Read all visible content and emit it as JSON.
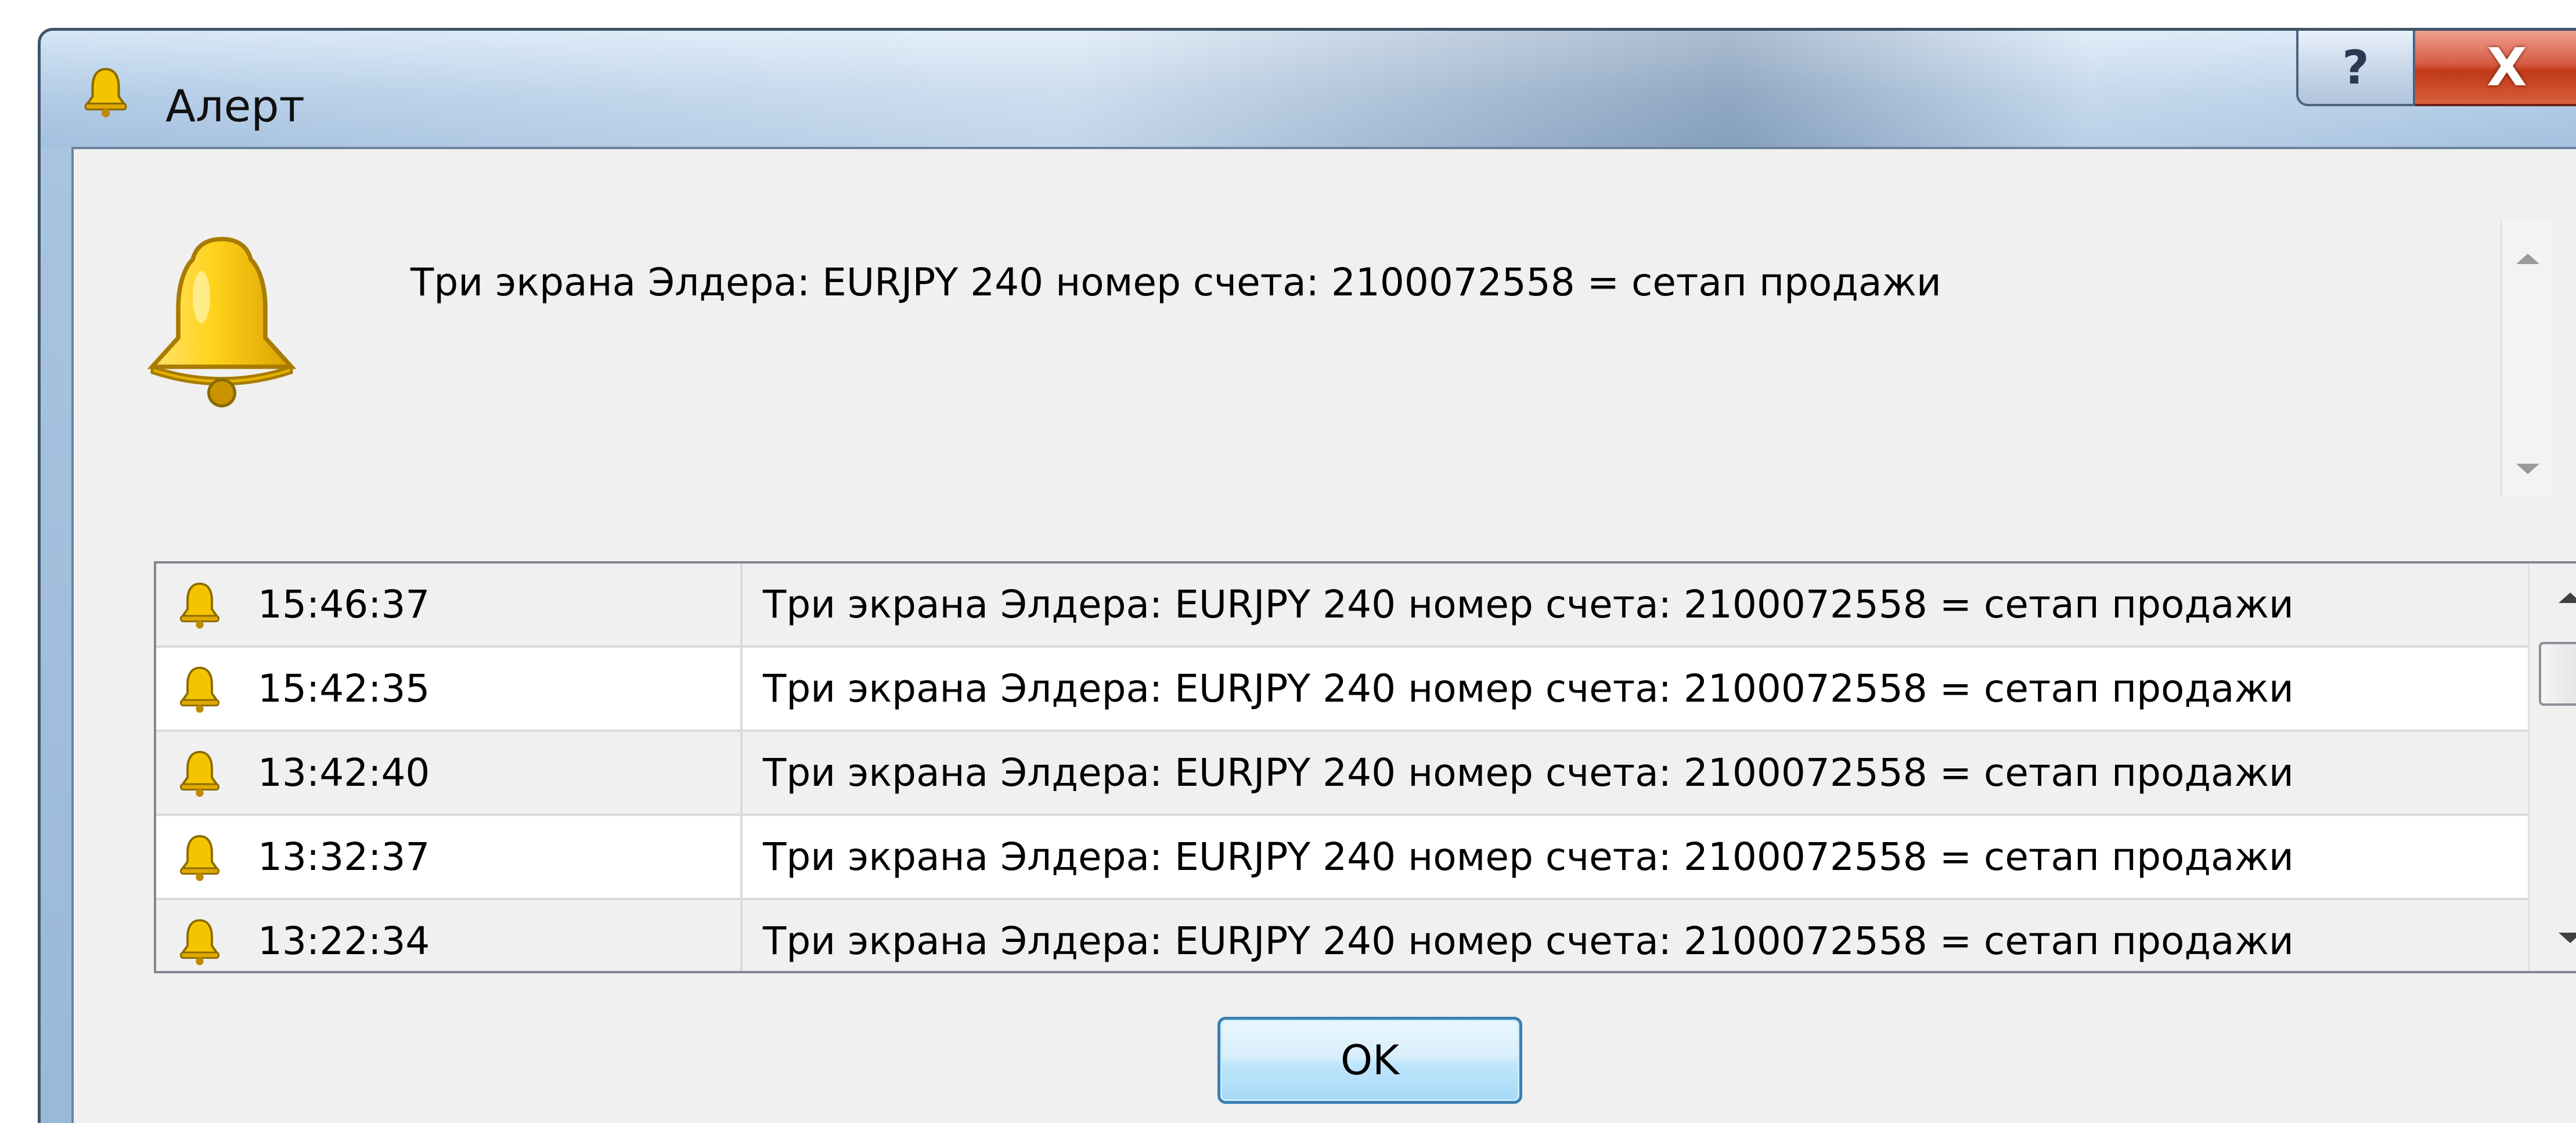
{
  "window": {
    "title": "Алерт",
    "help_glyph": "?",
    "close_glyph": "X"
  },
  "alert": {
    "message": "Три экрана Элдера: EURJPY  240 номер счета: 2100072558 = сетап продажи"
  },
  "history": [
    {
      "time": "15:46:37",
      "message": "Три экрана Элдера: EURJPY  240 номер счета: 2100072558 = сетап продажи"
    },
    {
      "time": "15:42:35",
      "message": "Три экрана Элдера: EURJPY  240 номер счета: 2100072558 = сетап продажи"
    },
    {
      "time": "13:42:40",
      "message": "Три экрана Элдера: EURJPY  240 номер счета: 2100072558 = сетап продажи"
    },
    {
      "time": "13:32:37",
      "message": "Три экрана Элдера: EURJPY  240 номер счета: 2100072558 = сетап продажи"
    },
    {
      "time": "13:22:34",
      "message": "Три экрана Элдера: EURJPY  240 номер счета: 2100072558 = сетап продажи"
    }
  ],
  "buttons": {
    "ok_label": "OK"
  },
  "icons": {
    "title": "bell-icon",
    "alert": "bell-icon",
    "row": "bell-icon"
  },
  "colors": {
    "bell_fill": "#f5c400",
    "close_button": "#c83a1c",
    "ok_border": "#3c7fb1"
  }
}
